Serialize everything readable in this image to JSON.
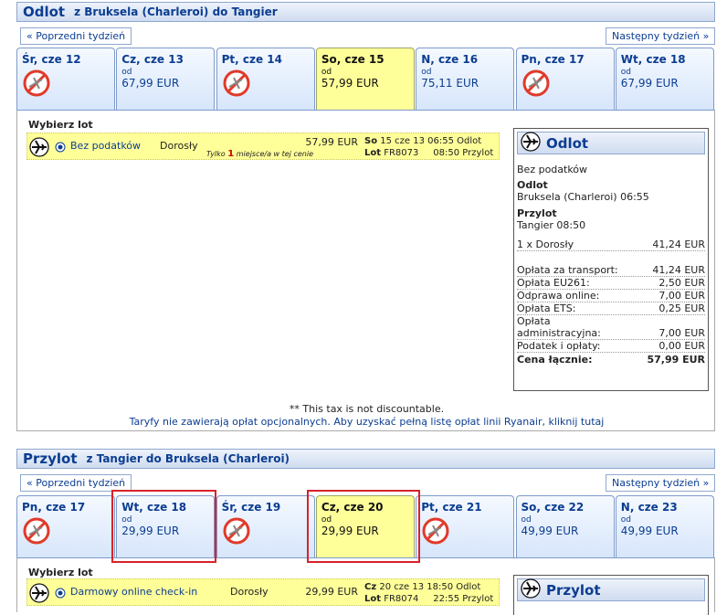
{
  "outbound": {
    "title": "Odlot",
    "route": "z Bruksela (Charleroi) do Tangier",
    "prev_week": "« Poprzedni tydzień",
    "next_week": "Następny tydzień »",
    "days": [
      {
        "label": "Śr, cze 12",
        "available": false,
        "od": "",
        "price": ""
      },
      {
        "label": "Cz, cze 13",
        "available": true,
        "od": "od",
        "price": "67,99 EUR"
      },
      {
        "label": "Pt, cze 14",
        "available": false,
        "od": "",
        "price": ""
      },
      {
        "label": "So, cze 15",
        "available": true,
        "od": "od",
        "price": "57,99 EUR",
        "selected": true
      },
      {
        "label": "N, cze 16",
        "available": true,
        "od": "od",
        "price": "75,11 EUR"
      },
      {
        "label": "Pn, cze 17",
        "available": false,
        "od": "",
        "price": ""
      },
      {
        "label": "Wt, cze 18",
        "available": true,
        "od": "od",
        "price": "67,99 EUR"
      }
    ],
    "choose_label": "Wybierz lot",
    "fare": {
      "name": "Bez podatków",
      "pax": "Dorosły",
      "price": "57,99 EUR",
      "seats_pre": "Tylko",
      "seats_num": "1",
      "seats_post": "miejsce/a w tej cenie",
      "day_abbr": "So",
      "date_time": "15 cze 13 06:55",
      "depart_word": "Odlot",
      "lot_label": "Lot",
      "flight_no": "FR8073",
      "arrive_time": "08:50",
      "arrive_word": "Przylot"
    },
    "summary": {
      "head": "Odlot",
      "fare_type": "Bez podatków",
      "dep_label": "Odlot",
      "dep_value": "Bruksela (Charleroi) 06:55",
      "arr_label": "Przylot",
      "arr_value": "Tangier 08:50",
      "rows": [
        {
          "label": "1 x Dorosły",
          "value": "41,24 EUR"
        },
        {
          "label": "Opłata za transport:",
          "value": "41,24 EUR"
        },
        {
          "label": "Opłata EU261:",
          "value": "2,50 EUR"
        },
        {
          "label": "Odprawa online:",
          "value": "7,00 EUR"
        },
        {
          "label": "Opłata ETS:",
          "value": "0,25 EUR"
        },
        {
          "label": "Opłata administracyjna:",
          "value": "7,00 EUR"
        },
        {
          "label": "Podatek i opłaty:",
          "value": "0,00 EUR"
        }
      ],
      "total_label": "Cena łącznie:",
      "total_value": "57,99 EUR"
    },
    "note_tax": "** This tax is not discountable.",
    "note_fees": "Taryfy nie zawierają opłat opcjonalnych. Aby uzyskać pełną listę opłat linii Ryanair, kliknij tutaj"
  },
  "inbound": {
    "title": "Przylot",
    "route": "z Tangier do Bruksela (Charleroi)",
    "prev_week": "« Poprzedni tydzień",
    "next_week": "Następny tydzień »",
    "days": [
      {
        "label": "Pn, cze 17",
        "available": false,
        "od": "",
        "price": ""
      },
      {
        "label": "Wt, cze 18",
        "available": true,
        "od": "od",
        "price": "29,99 EUR"
      },
      {
        "label": "Śr, cze 19",
        "available": false,
        "od": "",
        "price": ""
      },
      {
        "label": "Cz, cze 20",
        "available": true,
        "od": "od",
        "price": "29,99 EUR",
        "selected": true
      },
      {
        "label": "Pt, cze 21",
        "available": false,
        "od": "",
        "price": ""
      },
      {
        "label": "So, cze 22",
        "available": true,
        "od": "od",
        "price": "49,99 EUR"
      },
      {
        "label": "N, cze 23",
        "available": true,
        "od": "od",
        "price": "49,99 EUR"
      }
    ],
    "choose_label": "Wybierz lot",
    "fare": {
      "name": "Darmowy online check-in",
      "pax": "Dorosły",
      "price": "29,99 EUR",
      "day_abbr": "Cz",
      "date_time": "20 cze 13 18:50",
      "depart_word": "Odlot",
      "lot_label": "Lot",
      "flight_no": "FR8074",
      "arrive_time": "22:55",
      "arrive_word": "Przylot"
    },
    "summary": {
      "head": "Przylot"
    }
  },
  "colors": {
    "accent": "#0b3d91",
    "selected": "#ffff99",
    "highlight_box": "#d8232a"
  }
}
